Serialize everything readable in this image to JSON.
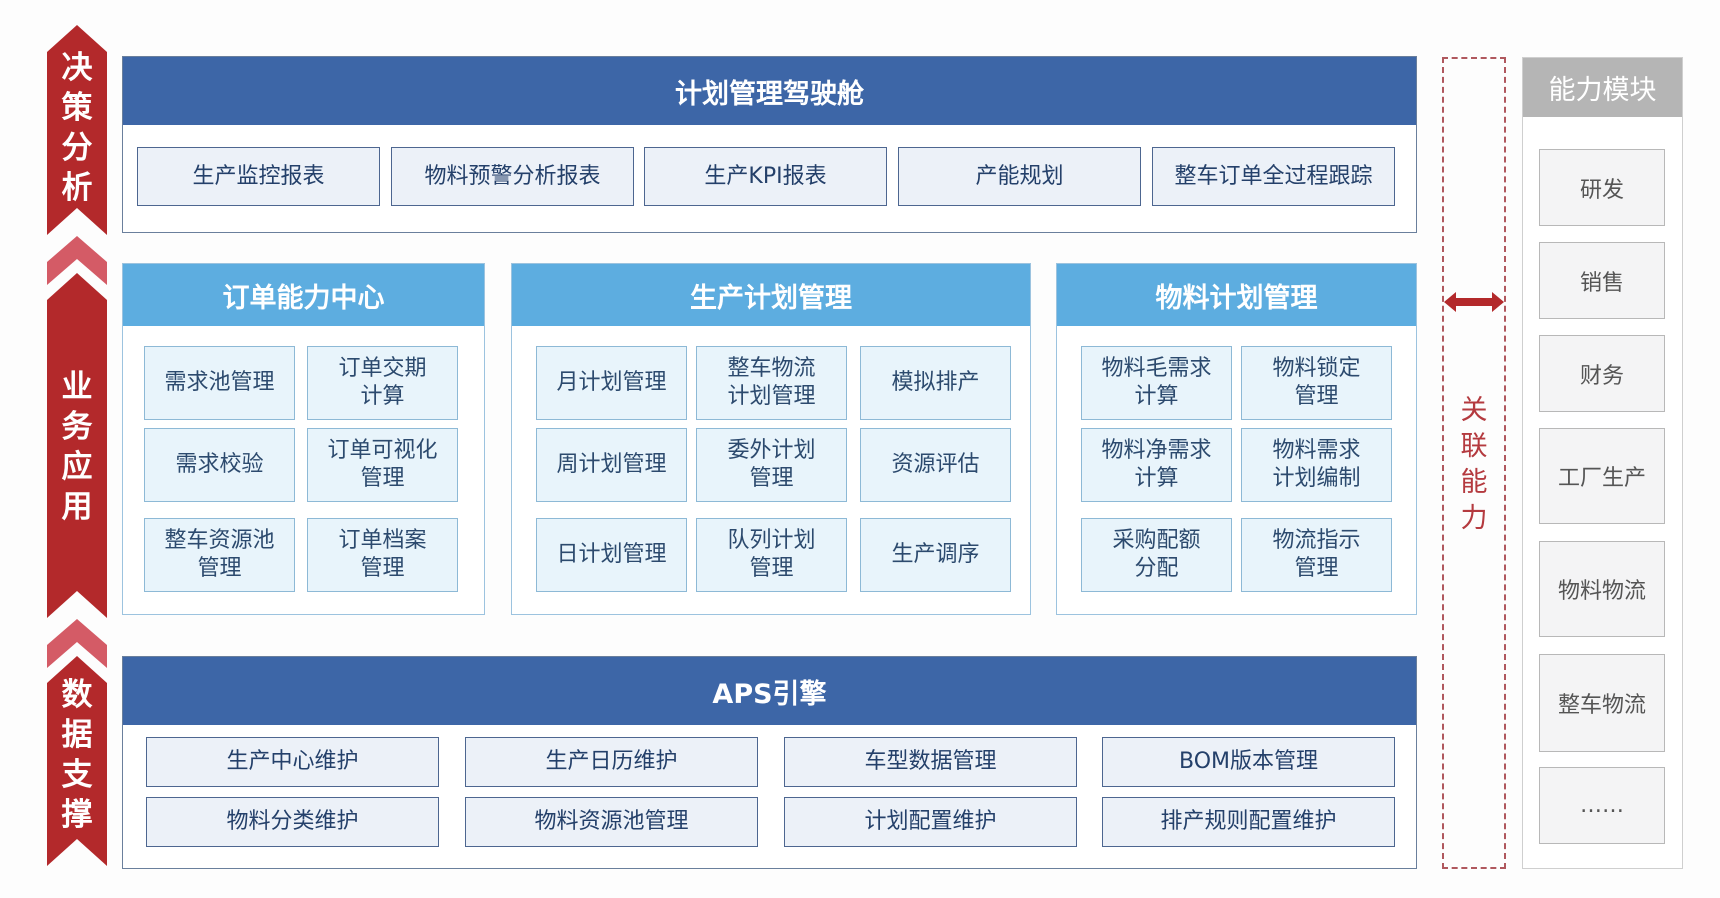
{
  "layers": [
    "决策分析",
    "业务应用",
    "数据支撑"
  ],
  "cockpit": {
    "title": "计划管理驾驶舱",
    "items": [
      "生产监控报表",
      "物料预警分析报表",
      "生产KPI报表",
      "产能规划",
      "整车订单全过程跟踪"
    ]
  },
  "order_center": {
    "title": "订单能力中心",
    "items": [
      "需求池管理",
      "订单交期\n计算",
      "需求校验",
      "订单可视化\n管理",
      "整车资源池\n管理",
      "订单档案\n管理"
    ]
  },
  "production_plan": {
    "title": "生产计划管理",
    "items": [
      "月计划管理",
      "整车物流\n计划管理",
      "模拟排产",
      "周计划管理",
      "委外计划\n管理",
      "资源评估",
      "日计划管理",
      "队列计划\n管理",
      "生产调序"
    ]
  },
  "material_plan": {
    "title": "物料计划管理",
    "items": [
      "物料毛需求\n计算",
      "物料锁定\n管理",
      "物料净需求\n计算",
      "物料需求\n计划编制",
      "采购配额\n分配",
      "物流指示\n管理"
    ]
  },
  "aps": {
    "title": "APS引擎",
    "items": [
      "生产中心维护",
      "生产日历维护",
      "车型数据管理",
      "BOM版本管理",
      "物料分类维护",
      "物料资源池管理",
      "计划配置维护",
      "排产规则配置维护"
    ]
  },
  "link": {
    "label": "关联能力",
    "icon": "double-arrow-icon"
  },
  "capability": {
    "title": "能力模块",
    "items": [
      "研发",
      "销售",
      "财务",
      "工厂生产",
      "物料物流",
      "整车物流",
      "……"
    ]
  },
  "colors": {
    "layer_red": "#b3292b",
    "chevron_pink": "#d45b66",
    "dark_blue": "#3d66a7",
    "light_blue": "#5dade0",
    "gray_header": "#b5b5b5"
  }
}
